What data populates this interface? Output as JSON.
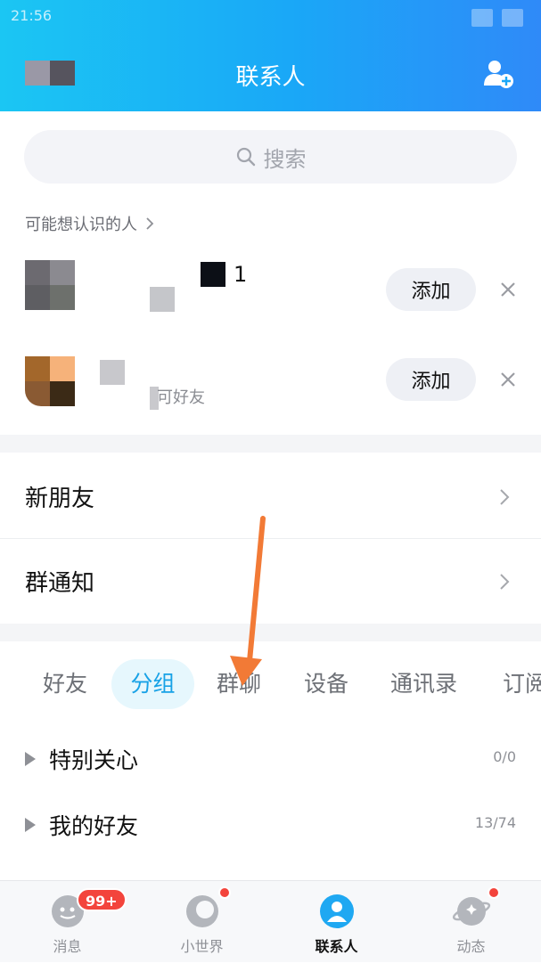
{
  "status": {
    "time": "21:56"
  },
  "header": {
    "title": "联系人"
  },
  "search": {
    "placeholder": "搜索"
  },
  "may_know": {
    "label": "可能想认识的人"
  },
  "suggestions": [
    {
      "name": "1",
      "sub": "",
      "add_label": "添加"
    },
    {
      "name": "",
      "sub": "可好友",
      "add_label": "添加"
    }
  ],
  "menu": [
    {
      "label": "新朋友"
    },
    {
      "label": "群通知"
    }
  ],
  "tabs": [
    "好友",
    "分组",
    "群聊",
    "设备",
    "通讯录",
    "订阅"
  ],
  "active_tab": "分组",
  "groups": [
    {
      "name": "特别关心",
      "count": "0/0"
    },
    {
      "name": "我的好友",
      "count": "13/74"
    }
  ],
  "bottom_nav": [
    {
      "label": "消息",
      "badge": "99+"
    },
    {
      "label": "小世界"
    },
    {
      "label": "联系人"
    },
    {
      "label": "动态"
    }
  ],
  "colors": {
    "accent": "#18a2e6",
    "header_start": "#1bc6f3",
    "header_end": "#2f8af8",
    "badge": "#f3443c",
    "annotation_arrow": "#f27a36"
  }
}
